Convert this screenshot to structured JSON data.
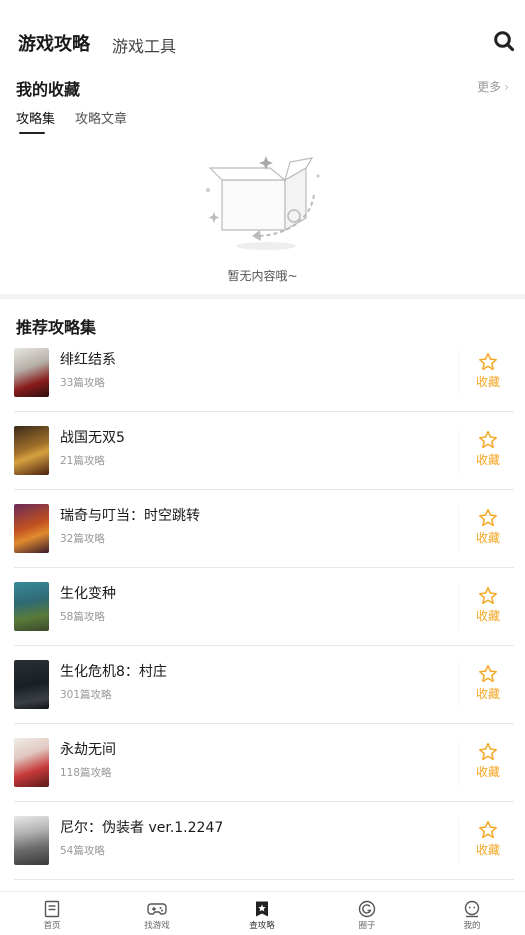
{
  "header": {
    "tab_active": "游戏攻略",
    "tab_inactive": "游戏工具"
  },
  "favorites": {
    "title": "我的收藏",
    "more_label": "更多",
    "subtabs": [
      "攻略集",
      "攻略文章"
    ],
    "empty_text": "暂无内容哦~"
  },
  "recommended": {
    "title": "推荐攻略集",
    "fav_label": "收藏",
    "items": [
      {
        "name": "绯红结系",
        "count": "33篇攻略",
        "cover": "#8a1c1c"
      },
      {
        "name": "战国无双5",
        "count": "21篇攻略",
        "cover": "#7a5a2a"
      },
      {
        "name": "瑞奇与叮当：时空跳转",
        "count": "32篇攻略",
        "cover": "#8a3a1a"
      },
      {
        "name": "生化变种",
        "count": "58篇攻略",
        "cover": "#2e6a74"
      },
      {
        "name": "生化危机8：村庄",
        "count": "301篇攻略",
        "cover": "#1a1f24"
      },
      {
        "name": "永劫无间",
        "count": "118篇攻略",
        "cover": "#c73a3a"
      },
      {
        "name": "尼尔：伪装者 ver.1.2247",
        "count": "54篇攻略",
        "cover": "#5a5a5a"
      }
    ]
  },
  "bottom_nav": {
    "items": [
      "首页",
      "找游戏",
      "查攻略",
      "圈子",
      "我的"
    ],
    "active_index": 2
  },
  "colors": {
    "accent": "#f5a623",
    "text_primary": "#1a1a1a",
    "text_secondary": "#999999"
  }
}
